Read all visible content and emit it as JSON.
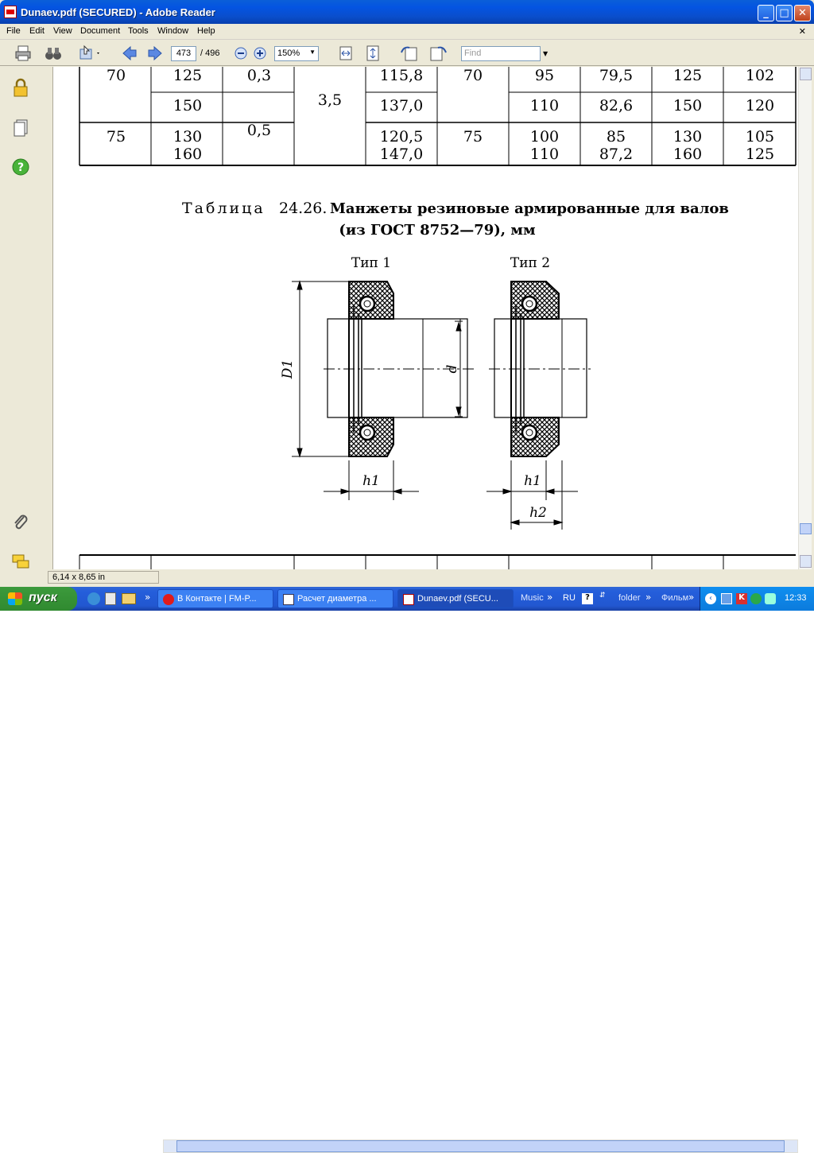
{
  "window": {
    "title": "Dunaev.pdf (SECURED) - Adobe Reader"
  },
  "menu": [
    "File",
    "Edit",
    "View",
    "Document",
    "Tools",
    "Window",
    "Help"
  ],
  "toolbar": {
    "page_current": "473",
    "page_total": "/ 496",
    "zoom": "150%",
    "find_placeholder": "Find"
  },
  "status": {
    "page_size": "6,14 x 8,65 in"
  },
  "document": {
    "table_top_rows": [
      [
        "70",
        "125",
        "0,3",
        "",
        "115,8",
        "70",
        "95",
        "79,5",
        "125",
        "102"
      ],
      [
        "",
        "150",
        "",
        "3,5",
        "137,0",
        "",
        "110",
        "82,6",
        "150",
        "120"
      ],
      [
        "75",
        "130",
        "0,5",
        "",
        "120,5",
        "75",
        "100",
        "85",
        "130",
        "105"
      ],
      [
        "",
        "160",
        "",
        "",
        "147,0",
        "",
        "110",
        "87,2",
        "160",
        "125"
      ]
    ],
    "caption_prefix": "Таблица",
    "caption_number": "24.26.",
    "caption_bold": "Манжеты резиновые армированные для валов",
    "caption_line2": "(из ГОСТ 8752—79), мм",
    "type1": "Тип 1",
    "type2": "Тип 2",
    "label_D1": "D1",
    "label_d": "d",
    "label_h1": "h1",
    "label_h1b": "h1",
    "label_h2": "h2"
  },
  "taskbar": {
    "start": "пуск",
    "tasks": [
      "В Контакте | FM-P...",
      "Расчет диаметра ...",
      "Dunaev.pdf (SECU..."
    ],
    "items": [
      "Music",
      "RU",
      "folder",
      "Фильм"
    ],
    "clock": "12:33"
  }
}
